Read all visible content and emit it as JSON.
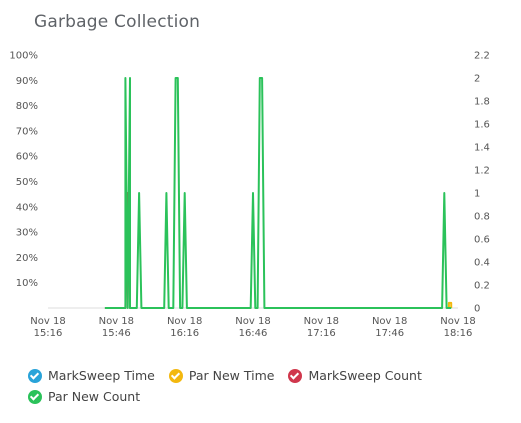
{
  "chart_data": {
    "type": "line",
    "title": "Garbage Collection",
    "x_ticks": [
      [
        "Nov 18",
        "15:16"
      ],
      [
        "Nov 18",
        "15:46"
      ],
      [
        "Nov 18",
        "16:16"
      ],
      [
        "Nov 18",
        "16:46"
      ],
      [
        "Nov 18",
        "17:16"
      ],
      [
        "Nov 18",
        "17:46"
      ],
      [
        "Nov 18",
        "18:16"
      ]
    ],
    "xlim": [
      "Nov 18 15:16",
      "Nov 18 18:16"
    ],
    "y_left": {
      "ticks": [
        "10%",
        "20%",
        "30%",
        "40%",
        "50%",
        "60%",
        "70%",
        "80%",
        "90%",
        "100%"
      ],
      "ylim": [
        0,
        100
      ]
    },
    "y_right": {
      "ticks": [
        "0",
        "0.2",
        "0.4",
        "0.6",
        "0.8",
        "1",
        "1.2",
        "1.4",
        "1.6",
        "1.8",
        "2",
        "2.2"
      ],
      "ylim": [
        0,
        2.2
      ]
    },
    "grid": false,
    "legend_position": "bottom",
    "series": [
      {
        "name": "MarkSweep Time",
        "color": "#29a3d9",
        "axis": "left",
        "x": [],
        "y": []
      },
      {
        "name": "Par New Time",
        "color": "#f3b80f",
        "axis": "left",
        "x": [
          "Nov 18 18:12",
          "Nov 18 18:12",
          "Nov 18 18:13",
          "Nov 18 18:13"
        ],
        "y": [
          0,
          2,
          2,
          0
        ]
      },
      {
        "name": "MarkSweep Count",
        "color": "#d0374c",
        "axis": "right",
        "x": [
          "Nov 18 15:41",
          "Nov 18 15:50",
          "Nov 18 15:51",
          "Nov 18 15:52",
          "Nov 18 15:53"
        ],
        "y": [
          0,
          0,
          1,
          0,
          0
        ]
      },
      {
        "name": "Par New Count",
        "color": "#2bc25a",
        "axis": "right",
        "x": [
          "Nov 18 15:41",
          "Nov 18 15:50",
          "Nov 18 15:50",
          "Nov 18 15:51",
          "Nov 18 15:52",
          "Nov 18 15:52",
          "Nov 18 15:53",
          "Nov 18 15:53",
          "Nov 18 15:54",
          "Nov 18 15:55",
          "Nov 18 15:56",
          "Nov 18 15:57",
          "Nov 18 15:58",
          "Nov 18 15:59",
          "Nov 18 16:00",
          "Nov 18 16:01",
          "Nov 18 16:02",
          "Nov 18 16:07",
          "Nov 18 16:08",
          "Nov 18 16:09",
          "Nov 18 16:10",
          "Nov 18 16:11",
          "Nov 18 16:12",
          "Nov 18 16:13",
          "Nov 18 16:14",
          "Nov 18 16:15",
          "Nov 18 16:16",
          "Nov 18 16:17",
          "Nov 18 16:18",
          "Nov 18 16:44",
          "Nov 18 16:45",
          "Nov 18 16:46",
          "Nov 18 16:47",
          "Nov 18 16:48",
          "Nov 18 16:49",
          "Nov 18 16:50",
          "Nov 18 16:51",
          "Nov 18 16:52",
          "Nov 18 16:53",
          "Nov 18 16:54",
          "Nov 18 17:00",
          "Nov 18 17:01",
          "Nov 18 17:02",
          "Nov 18 17:26",
          "Nov 18 18:06",
          "Nov 18 18:08",
          "Nov 18 18:09",
          "Nov 18 18:10",
          "Nov 18 18:11",
          "Nov 18 18:12",
          "Nov 18 18:13"
        ],
        "y": [
          0,
          0,
          2,
          0,
          2,
          0,
          0,
          0,
          0,
          0,
          1,
          0,
          0,
          0,
          0,
          0,
          0,
          0,
          1,
          0,
          0,
          0,
          2,
          2,
          0,
          0,
          1,
          0,
          0,
          0,
          0,
          1,
          0,
          0,
          2,
          2,
          0,
          0,
          0,
          0,
          0,
          0,
          0,
          0,
          0,
          0,
          0,
          1,
          0,
          0,
          0
        ]
      }
    ]
  },
  "legend": [
    {
      "label": "MarkSweep Time",
      "color": "#29a3d9"
    },
    {
      "label": "Par New Time",
      "color": "#f3b80f"
    },
    {
      "label": "MarkSweep Count",
      "color": "#d0374c"
    },
    {
      "label": "Par New Count",
      "color": "#2bc25a"
    }
  ]
}
